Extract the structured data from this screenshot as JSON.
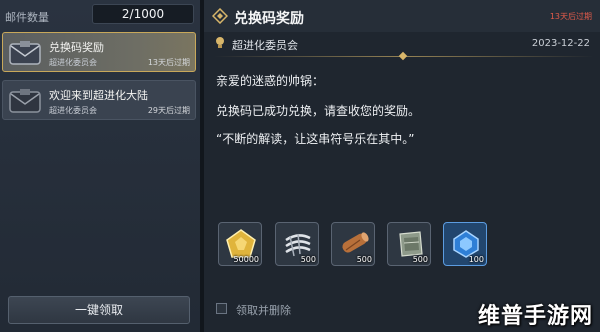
{
  "left": {
    "count_label": "邮件数量",
    "count_value": "2/1000",
    "mails": [
      {
        "title": "兑换码奖励",
        "from": "超进化委员会",
        "expire": "13天后过期",
        "selected": true
      },
      {
        "title": "欢迎来到超进化大陆",
        "from": "超进化委员会",
        "expire": "29天后过期",
        "selected": false
      }
    ],
    "claim_all": "一键领取"
  },
  "detail": {
    "title": "兑换码奖励",
    "expire": "13天后过期",
    "sender": "超进化委员会",
    "date": "2023-12-22",
    "lines": [
      "亲爱的迷惑的帅锅：",
      "兑换码已成功兑换，请查收您的奖励。",
      "“不断的解读，让这串符号乐在其中。”"
    ],
    "rewards": [
      {
        "icon": "gold-pentagon-icon",
        "qty": "50000",
        "color": "#b98a2a"
      },
      {
        "icon": "claw-scratch-icon",
        "qty": "500",
        "color": "#3a424c"
      },
      {
        "icon": "wood-log-icon",
        "qty": "500",
        "color": "#4a3a30"
      },
      {
        "icon": "armor-plate-icon",
        "qty": "500",
        "color": "#3c4540"
      },
      {
        "icon": "blue-crystal-icon",
        "qty": "100",
        "color": "#1e4f8a"
      }
    ],
    "checkbox_label": "领取并删除"
  },
  "watermark": "维普手游网",
  "colors": {
    "accent_gold": "#c8a85a",
    "expire_red": "#e05a4a"
  }
}
